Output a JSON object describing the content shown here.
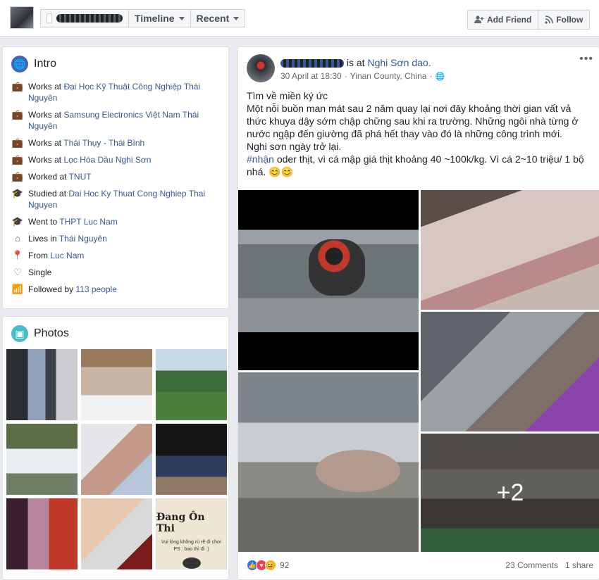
{
  "topbar": {
    "nav": {
      "timeline": "Timeline",
      "recent": "Recent"
    },
    "actions": {
      "add_friend": "Add Friend",
      "follow": "Follow"
    }
  },
  "intro": {
    "title": "Intro",
    "items": [
      {
        "icon": "briefcase-icon",
        "prefix": "Works at",
        "link": "Đại Học Kỹ Thuật Công Nghiệp Thái Nguyên"
      },
      {
        "icon": "briefcase-icon",
        "prefix": "Works at",
        "link": "Samsung Electronics Việt Nam Thái Nguyên"
      },
      {
        "icon": "briefcase-icon",
        "prefix": "Works at",
        "link": "Thái Thụy - Thái Bình"
      },
      {
        "icon": "briefcase-icon",
        "prefix": "Works at",
        "link": "Lọc Hóa Dầu Nghi Sơn"
      },
      {
        "icon": "briefcase-icon",
        "prefix": "Worked at",
        "link": "TNUT"
      },
      {
        "icon": "graduation-cap-icon",
        "prefix": "Studied at",
        "link": "Dai Hoc Ky Thuat Cong Nghiep Thai Nguyen"
      },
      {
        "icon": "graduation-cap-icon",
        "prefix": "Went to",
        "link": "THPT Luc Nam"
      },
      {
        "icon": "home-icon",
        "prefix": "Lives in",
        "link": "Thái Nguyên"
      },
      {
        "icon": "location-pin-icon",
        "prefix": "From",
        "link": "Luc Nam"
      },
      {
        "icon": "heart-icon",
        "prefix": "Single",
        "link": ""
      },
      {
        "icon": "followers-icon",
        "prefix": "Followed by",
        "link": "113 people"
      }
    ]
  },
  "photos": {
    "title": "Photos",
    "sign": {
      "line1": "Đang Ôn Thi",
      "line2": "Vui lòng không rủ rê đi chơi",
      "line3": "PS : bao thì đi :)"
    }
  },
  "post": {
    "is_at": "is at",
    "place": "Nghi Sơn dao.",
    "date": "30 April at 18:30",
    "location": "Yinan County, China",
    "body_line1": "Tìm về miền ký ức",
    "body_line2": "Một nỗi buồn man mát sau 2 năm quay lại nơi đây khoảng thời gian vất vả thức khuya dậy sớm chập chững sau khi ra trường. Những ngôi nhà từng ở nước ngập đến giường đã phá hết thay vào đó là những công trình mới.",
    "body_line3": "Nghi sơn ngày trở lại.",
    "hashtag": "#nhận",
    "body_line4": " oder thịt, vì cá mập giá thịt khoảng 40 ~100k/kg. Vì cá 2~10 triệu/ 1 bộ nhá. 😊😊",
    "more_photos": "+2",
    "reactions_count": "92",
    "comments": "23 Comments",
    "shares": "1 share"
  }
}
